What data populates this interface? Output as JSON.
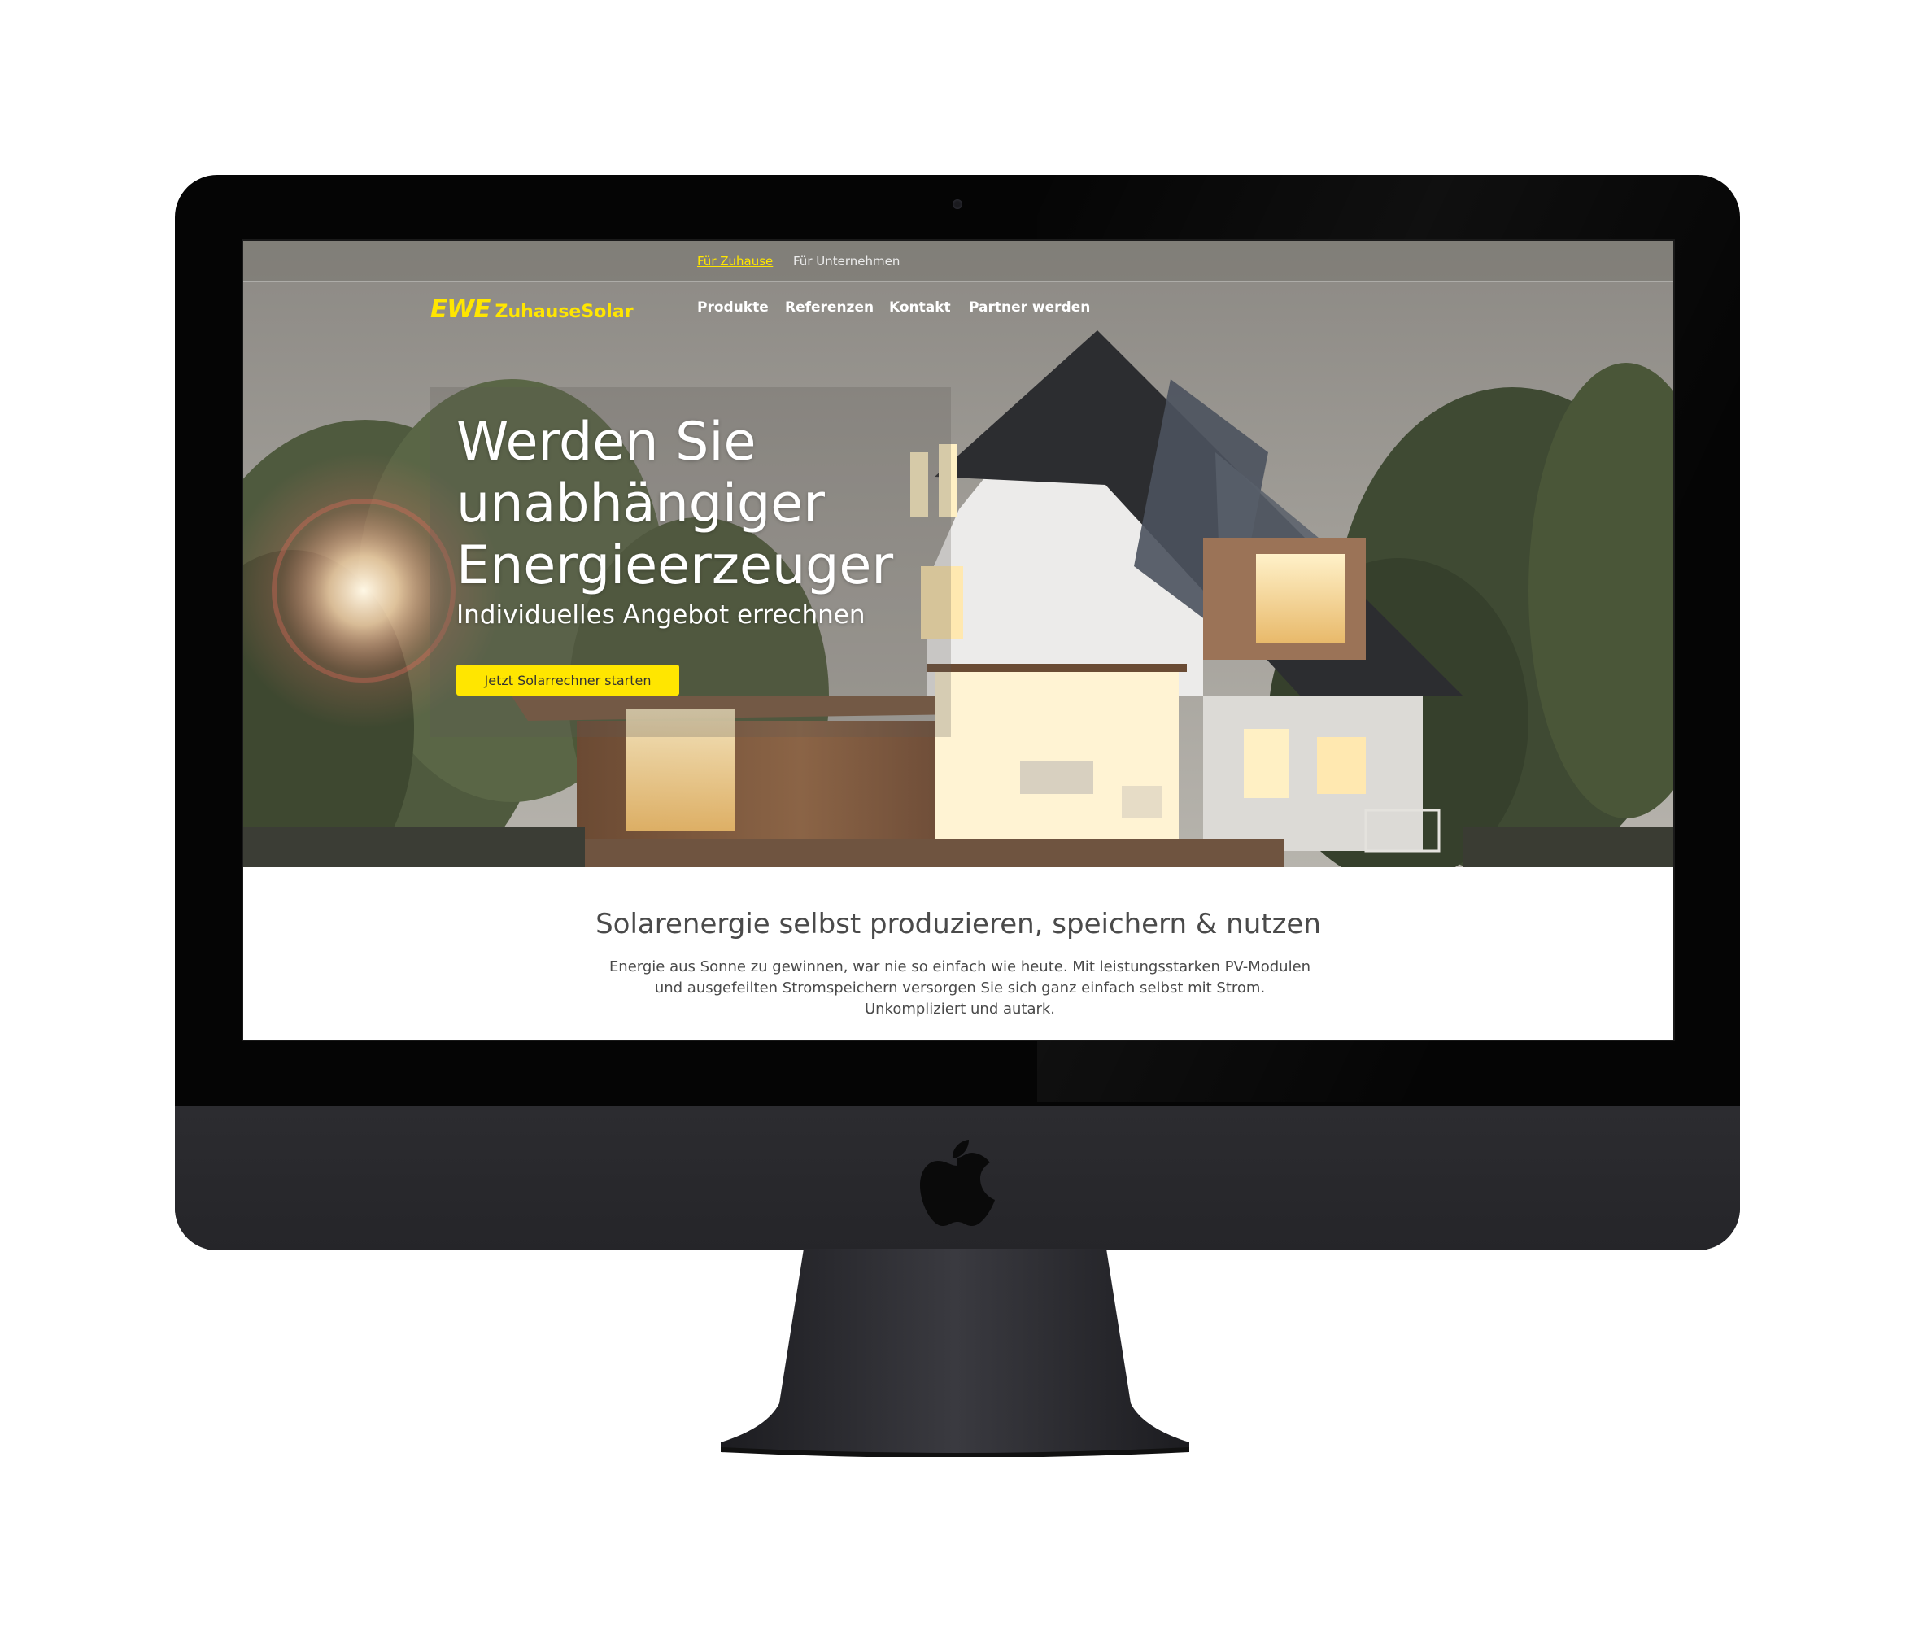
{
  "topbar": {
    "items": [
      {
        "label": "Für Zuhause",
        "active": true
      },
      {
        "label": "Für Unternehmen",
        "active": false
      }
    ]
  },
  "logo": {
    "primary": "EWE",
    "secondary": "ZuhauseSolar"
  },
  "nav": {
    "items": [
      {
        "label": "Produkte"
      },
      {
        "label": "Referenzen"
      },
      {
        "label": "Kontakt"
      },
      {
        "label": "Partner werden"
      }
    ]
  },
  "hero": {
    "title_lines": [
      "Werden Sie",
      "unabhängiger",
      "Energieerzeuger"
    ],
    "subtitle": "Individuelles Angebot errechnen",
    "cta_label": "Jetzt Solarrechner starten"
  },
  "intro": {
    "heading": "Solarenergie selbst produzieren, speichern & nutzen",
    "body": "Energie aus Sonne zu gewinnen, war nie so einfach wie heute. Mit leistungsstarken PV-Modulen und ausgefeilten Stromspeichern versorgen Sie sich ganz einfach selbst mit Strom. Unkompliziert und autark."
  },
  "colors": {
    "accent": "#ffe600",
    "monitor_bezel": "#050505",
    "monitor_chin": "#2c2c30",
    "text_dark": "#4a4a4a"
  },
  "icons": {
    "monitor_logo": "apple-logo-icon"
  }
}
